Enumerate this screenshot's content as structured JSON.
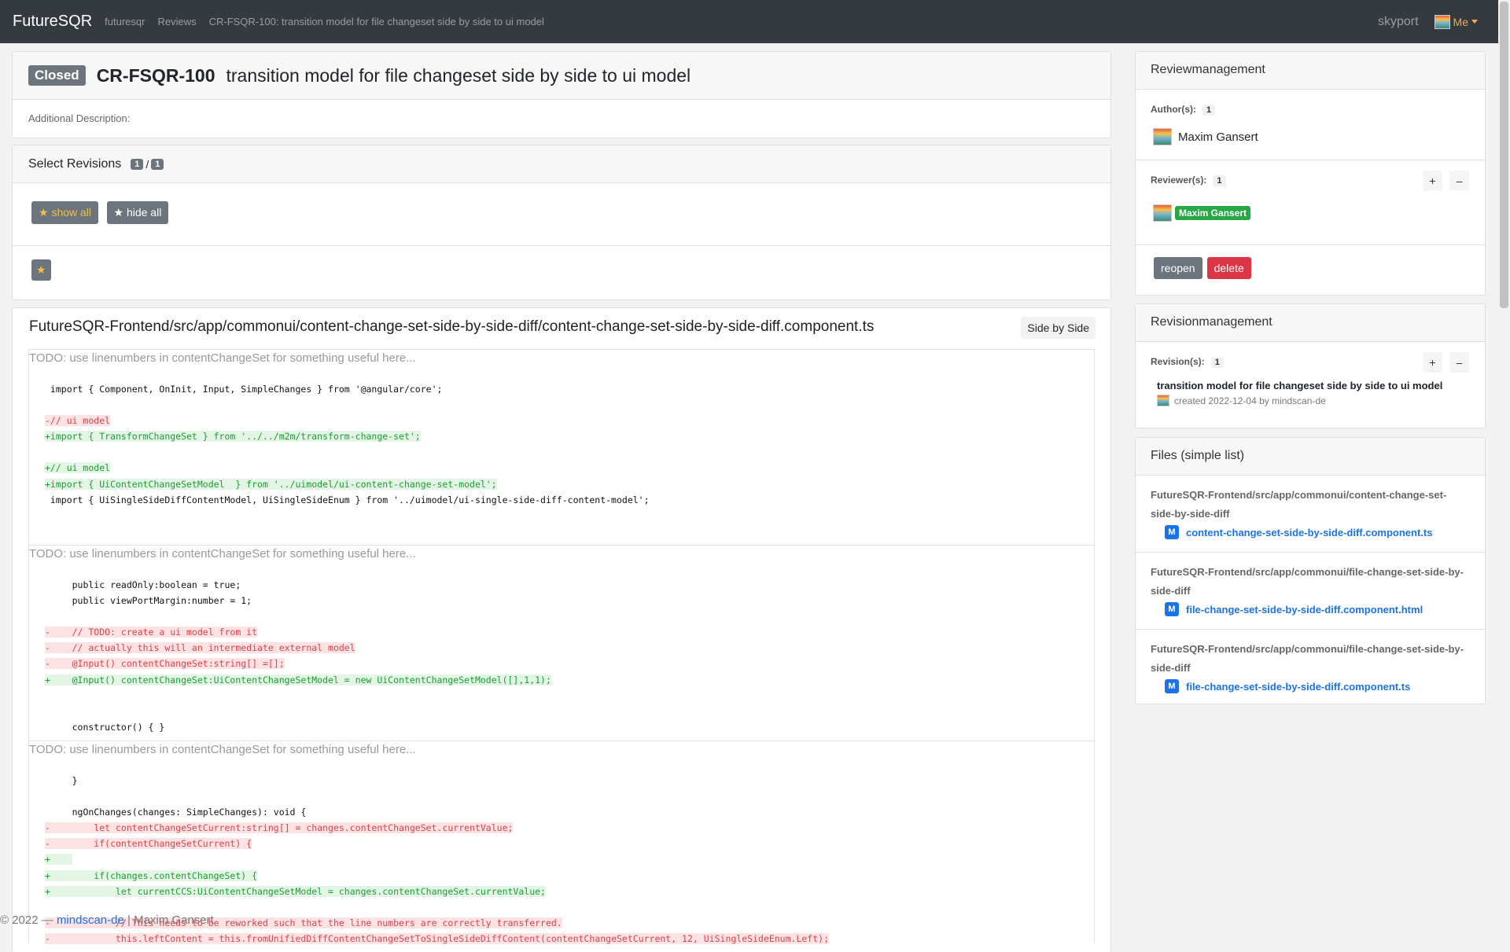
{
  "navbar": {
    "brand": "FutureSQR",
    "links": [
      "futuresqr",
      "Reviews",
      "CR-FSQR-100: transition model for file changeset side by side to ui model"
    ],
    "server": "skyport",
    "user": "Me"
  },
  "review": {
    "status": "Closed",
    "id": "CR-FSQR-100",
    "title": "transition model for file changeset side by side to ui model",
    "additional_description_label": "Additional Description:"
  },
  "revisions_select": {
    "title": "Select Revisions",
    "selected": "1",
    "separator": "/",
    "total": "1",
    "show_all": "show all",
    "hide_all": "hide all"
  },
  "file_diff": {
    "path": "FutureSQR-Frontend/src/app/commonui/content-change-set-side-by-side-diff/content-change-set-side-by-side-diff.component.ts",
    "view_mode": "Side by Side",
    "hunks": [
      {
        "todo": "TODO: use linenumbers in contentChangeSet for something useful here...",
        "lines": [
          {
            "type": "normal",
            "text": " import { Component, OnInit, Input, SimpleChanges } from '@angular/core';"
          },
          {
            "type": "blank",
            "text": ""
          },
          {
            "type": "removed",
            "text": "-// ui model"
          },
          {
            "type": "added",
            "text": "+import { TransformChangeSet } from '../../m2m/transform-change-set';"
          },
          {
            "type": "blank",
            "text": ""
          },
          {
            "type": "added",
            "text": "+// ui model"
          },
          {
            "type": "added",
            "text": "+import { UiContentChangeSetModel  } from '../uimodel/ui-content-change-set-model';"
          },
          {
            "type": "normal",
            "text": " import { UiSingleSideDiffContentModel, UiSingleSideEnum } from '../uimodel/ui-single-side-diff-content-model';"
          },
          {
            "type": "blank",
            "text": ""
          },
          {
            "type": "blank",
            "text": ""
          }
        ]
      },
      {
        "todo": "TODO: use linenumbers in contentChangeSet for something useful here...",
        "lines": [
          {
            "type": "normal",
            "text": "     public readOnly:boolean = true;"
          },
          {
            "type": "normal",
            "text": "     public viewPortMargin:number = 1;"
          },
          {
            "type": "blank",
            "text": ""
          },
          {
            "type": "removed",
            "text": "-    // TODO: create a ui model from it"
          },
          {
            "type": "removed",
            "text": "-    // actually this will an intermediate external model"
          },
          {
            "type": "removed",
            "text": "-    @Input() contentChangeSet:string[] =[];"
          },
          {
            "type": "added",
            "text": "+    @Input() contentChangeSet:UiContentChangeSetModel = new UiContentChangeSetModel([],1,1);"
          },
          {
            "type": "blank",
            "text": ""
          },
          {
            "type": "blank",
            "text": ""
          },
          {
            "type": "normal",
            "text": "     constructor() { }"
          }
        ]
      },
      {
        "todo": "TODO: use linenumbers in contentChangeSet for something useful here...",
        "lines": [
          {
            "type": "normal",
            "text": "     }"
          },
          {
            "type": "blank",
            "text": ""
          },
          {
            "type": "normal",
            "text": "     ngOnChanges(changes: SimpleChanges): void {"
          },
          {
            "type": "removed",
            "text": "-        let contentChangeSetCurrent:string[] = changes.contentChangeSet.currentValue;"
          },
          {
            "type": "removed",
            "text": "-        if(contentChangeSetCurrent) {"
          },
          {
            "type": "added",
            "text": "+    "
          },
          {
            "type": "added",
            "text": "+        if(changes.contentChangeSet) {"
          },
          {
            "type": "added",
            "text": "+            let currentCCS:UiContentChangeSetModel = changes.contentChangeSet.currentValue;"
          },
          {
            "type": "blank",
            "text": ""
          },
          {
            "type": "removed",
            "text": "-            // This needs to be reworked such that the line numbers are correctly transferred."
          },
          {
            "type": "removed",
            "text": "-            this.leftContent = this.fromUnifiedDiffContentChangeSetToSingleSideDiffContent(contentChangeSetCurrent, 12, UiSingleSideEnum.Left);"
          }
        ]
      }
    ]
  },
  "review_management": {
    "title": "Reviewmanagement",
    "authors_label": "Author(s):",
    "authors_count": "1",
    "author_name": "Maxim Gansert",
    "reviewers_label": "Reviewer(s):",
    "reviewers_count": "1",
    "reviewer_name": "Maxim Gansert",
    "plus": "+",
    "minus": "–",
    "reopen": "reopen",
    "delete": "delete"
  },
  "revision_management": {
    "title": "Revisionmanagement",
    "revisions_label": "Revision(s):",
    "revisions_count": "1",
    "plus": "+",
    "minus": "–",
    "revision_title": "transition model for file changeset side by side to ui model",
    "revision_meta": "created 2022-12-04 by mindscan-de"
  },
  "files": {
    "title": "Files (simple list)",
    "items": [
      {
        "dir": "FutureSQR-Frontend/src/app/commonui/content-change-set-side-by-side-diff",
        "badge": "M",
        "file": "content-change-set-side-by-side-diff.component.ts"
      },
      {
        "dir": "FutureSQR-Frontend/src/app/commonui/file-change-set-side-by-side-diff",
        "badge": "M",
        "file": "file-change-set-side-by-side-diff.component.html"
      },
      {
        "dir": "FutureSQR-Frontend/src/app/commonui/file-change-set-side-by-side-diff",
        "badge": "M",
        "file": "file-change-set-side-by-side-diff.component.ts"
      }
    ]
  },
  "footer": {
    "copyright": "© 2022 —",
    "link": "mindscan-de",
    "separator": "|",
    "author": "Maxim Gansert"
  },
  "colors": {
    "navbar": "#343a40",
    "removed": "#d9434b",
    "added": "#1e9b35",
    "link": "#1a73e8",
    "delete": "#dc3545",
    "reviewer_badge": "#28a745"
  }
}
